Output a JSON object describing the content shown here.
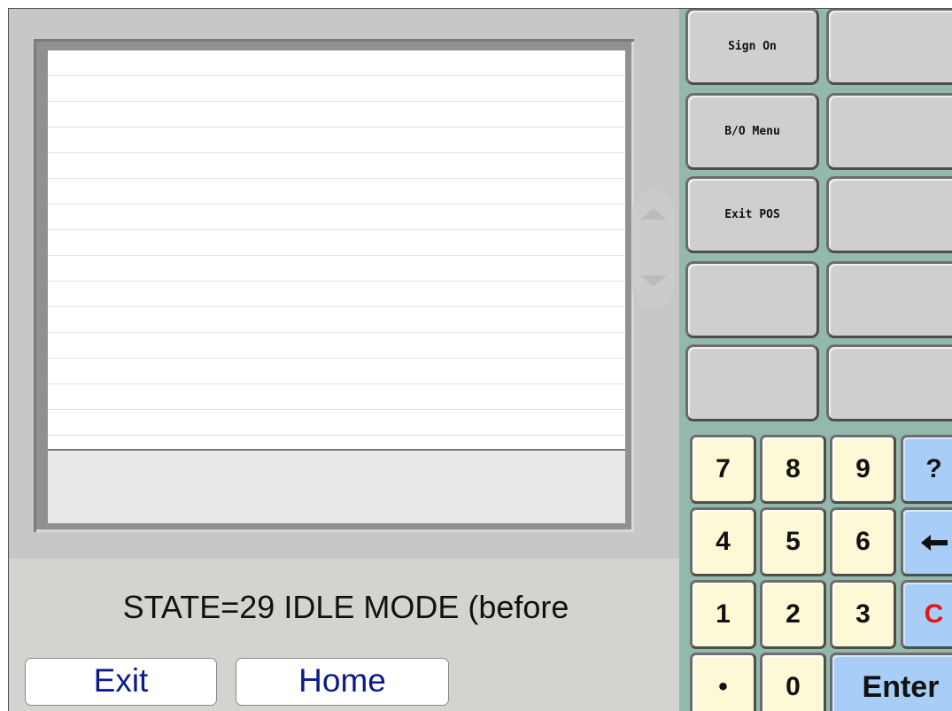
{
  "status": {
    "text": "STATE=29 IDLE MODE (before"
  },
  "nav": {
    "exit_label": "Exit",
    "home_label": "Home"
  },
  "function_keys": [
    {
      "label": "Sign On"
    },
    {
      "label": ""
    },
    {
      "label": "B/O Menu"
    },
    {
      "label": ""
    },
    {
      "label": "Exit POS"
    },
    {
      "label": ""
    },
    {
      "label": ""
    },
    {
      "label": ""
    },
    {
      "label": ""
    },
    {
      "label": ""
    }
  ],
  "keypad": {
    "k7": "7",
    "k8": "8",
    "k9": "9",
    "help": "?",
    "k4": "4",
    "k5": "5",
    "k6": "6",
    "backspace_icon": "left-arrow-icon",
    "k1": "1",
    "k2": "2",
    "k3": "3",
    "clear": "C",
    "dot": "•",
    "k0": "0",
    "enter": "Enter"
  },
  "colors": {
    "panel_teal": "#93b9ad",
    "key_cream": "#fdf9d6",
    "key_blue": "#a8cdf6",
    "clear_red": "#e81414",
    "nav_text": "#0b1a8c"
  }
}
